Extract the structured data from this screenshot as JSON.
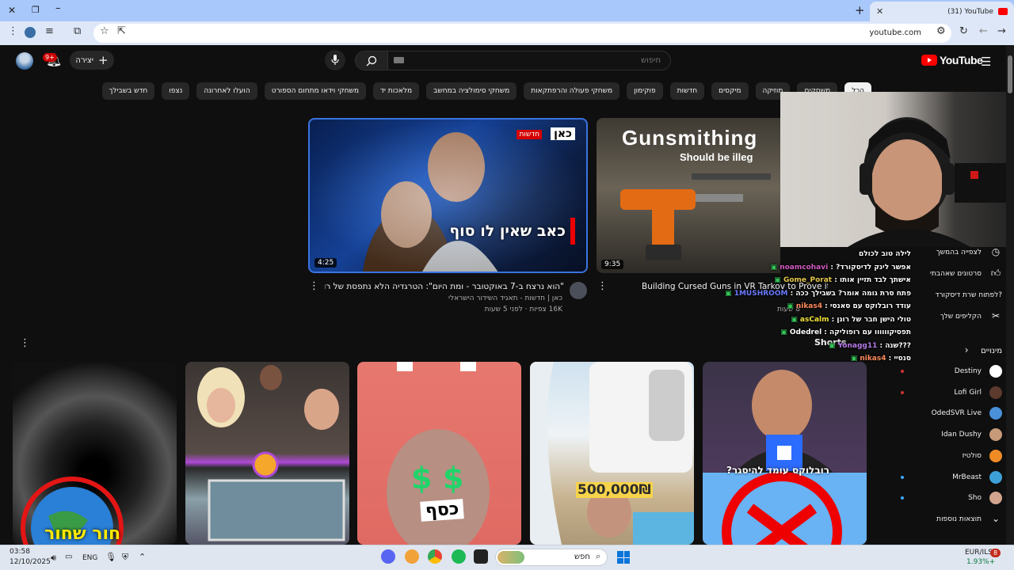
{
  "browser": {
    "tab_title": "(31) YouTube",
    "url": "youtube.com"
  },
  "header": {
    "create_label": "יצירה",
    "notifications_badge": "9+",
    "search_placeholder": "חיפוש",
    "logo_text": "YouTube"
  },
  "chips": [
    "הכל",
    "משחקים",
    "מוזיקה",
    "מיקסים",
    "חדשות",
    "פוקימון",
    "משחקי פעולה והרפתקאות",
    "משחקי סימולציה במחשב",
    "מלאכות יד",
    "משחקי וידאו מתחום הספורט",
    "הועלו לאחרונה",
    "נצפו",
    "חדש בשבילך"
  ],
  "videos": [
    {
      "duration": "4:25",
      "overlay_text": "כאב שאין לו סוף",
      "brand": "כאן",
      "brand_tag": "חדשות",
      "title": "\"הוא נרצח ב-7 באוקטובר - ומת היום\": הטרגדיה הלא נתפסת של רועי שלו",
      "channel": "כאן | חדשות - תאגיד השידור הישראלי",
      "meta": "16K צפיות · לפני 5 שעות"
    },
    {
      "duration": "9:35",
      "overlay_text": "Gunsmithing",
      "overlay_sub": "Should be illeg",
      "title": "Building Cursed Guns in VR Tarkov to Prove it's all Luck",
      "meta": "8 שעות"
    }
  ],
  "shorts_label": "Shorts",
  "shorts": [
    {
      "overlay": "חור שחור"
    },
    {
      "overlay": ""
    },
    {
      "overlay": "כסף"
    },
    {
      "overlay": "500,000₪"
    },
    {
      "overlay": "רובלוקס עומד להיסגר?"
    }
  ],
  "sidebar": {
    "watch_later": "לצפייה בהמשך",
    "liked_videos": "סרטונים שאהבתי",
    "your_videos": "לפתוח שרת דיסקורד?",
    "clips": "הקליפים שלך",
    "subscriptions_title": "מינויים",
    "subscriptions": [
      {
        "name": "Destiny",
        "live": true
      },
      {
        "name": "Lofi Girl",
        "live": true
      },
      {
        "name": "OdedSVR Live",
        "live": false
      },
      {
        "name": "Idan Dushy",
        "live": false
      },
      {
        "name": "סולטיז",
        "live": false
      },
      {
        "name": "MrBeast",
        "live": true
      },
      {
        "name": "Sho",
        "live": true
      }
    ],
    "show_more": "תוצאות נוספות"
  },
  "chat": [
    {
      "user": "",
      "msg": "לילה טוב לכולם"
    },
    {
      "user": "noamcohavi",
      "msg": "אפשר לינק לדיסקורד?"
    },
    {
      "user": "Gome_Porat",
      "msg": "אישתך לבד תזיין אותו"
    },
    {
      "user": "1MUSHROOM",
      "msg": "פתח סרת גומה אומר? בשבילך ככה"
    },
    {
      "user": "nikas4",
      "msg": "עודד רובלוקס עם סאנסי"
    },
    {
      "user": "asCalm",
      "msg": "טולי הישן חבר של רונן"
    },
    {
      "user": "Odedrel",
      "msg": "תפסיקוווווו עם רופוליקה"
    },
    {
      "user": "Yonagg11",
      "msg": "???שנה"
    },
    {
      "user": "nikas4",
      "msg": "סנסיי"
    }
  ],
  "taskbar": {
    "time": "03:58",
    "date": "12/10/2025",
    "lang": "ENG",
    "search": "חפש",
    "ticker": "EUR/ILS",
    "ticker_change": "1.93%+",
    "notif_count": "8"
  },
  "colors": {
    "yt_red": "#ff0000",
    "bg": "#0f0f0f",
    "chip": "#272727"
  }
}
